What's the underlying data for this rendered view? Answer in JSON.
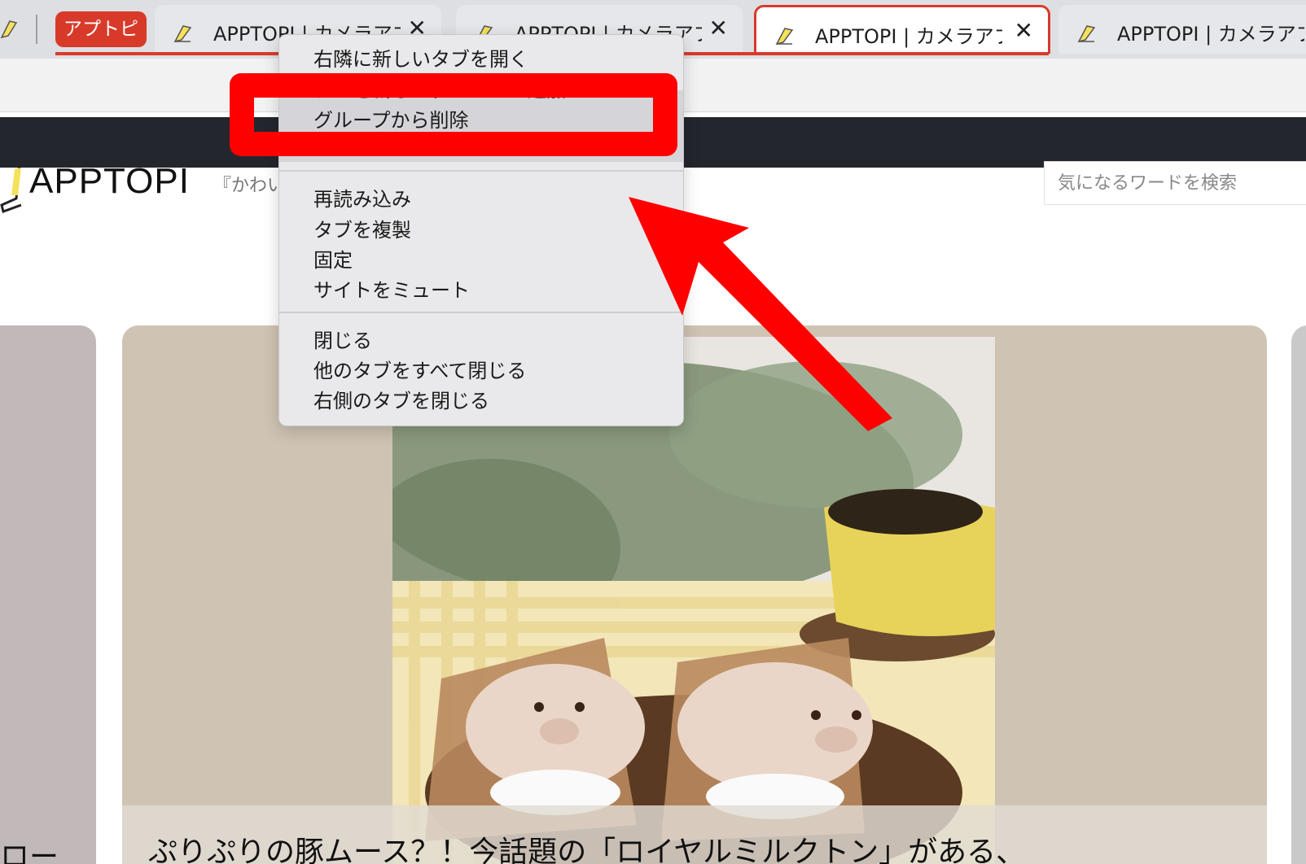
{
  "tabs": {
    "group_label": "アプトピ",
    "items": [
      {
        "title": "APPTOPI | カメラアプリ"
      },
      {
        "title": "APPTOPI | カメラアプリ"
      },
      {
        "title": "APPTOPI | カメラアプリ"
      },
      {
        "title": "APPTOPI | カメラアプリ"
      }
    ],
    "close_glyph": "✕",
    "accent_color": "#d83a2a"
  },
  "site": {
    "logo_text": "APPTOPI",
    "tagline": "『かわいい",
    "search_placeholder": "気になるワードを検索"
  },
  "context_menu": {
    "items_group1": [
      "右隣に新しいタブを開く",
      "タブを新しいグループに追加",
      "グループから削除"
    ],
    "items_group2": [
      "再読み込み",
      "タブを複製",
      "固定",
      "サイトをミュート"
    ],
    "items_group3": [
      "閉じる",
      "他のタブをすべて閉じる",
      "右側のタブを閉じる"
    ]
  },
  "cards": {
    "left_partial_text": "ロー",
    "main_title": "ぷりぷりの豚ムース？！今話題の「ロイヤルミルクトン」がある、"
  },
  "annotation": {
    "highlight_color": "#ff0000"
  }
}
